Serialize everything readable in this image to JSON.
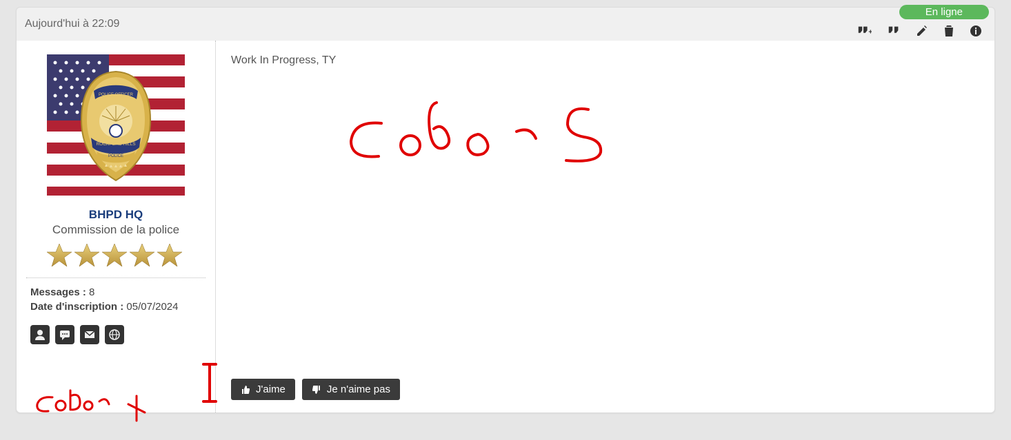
{
  "header": {
    "timestamp": "Aujourd'hui à 22:09",
    "status": "En ligne",
    "actions": {
      "multiquote": "quote-plus-icon",
      "quote": "quote-icon",
      "edit": "pencil-icon",
      "delete": "trash-icon",
      "info": "info-icon"
    }
  },
  "user": {
    "name": "BHPD HQ",
    "role": "Commission de la police",
    "rank_stars": 5,
    "badge": {
      "top_text": "POLICE OFFICER",
      "mid_text": "ROCKFORD HILLS",
      "bottom_text": "POLICE"
    },
    "meta": {
      "messages_label": "Messages :",
      "messages_value": "8",
      "joined_label": "Date d'inscription :",
      "joined_value": "05/07/2024"
    },
    "contact_icons": [
      "profile-icon",
      "chat-icon",
      "mail-icon",
      "globe-icon"
    ]
  },
  "post": {
    "text": "Work In Progress, TY"
  },
  "vote": {
    "like": "J'aime",
    "dislike": "Je n'aime pas"
  },
  "annotations": {
    "a1": "color 1",
    "a2": "Color 2"
  }
}
